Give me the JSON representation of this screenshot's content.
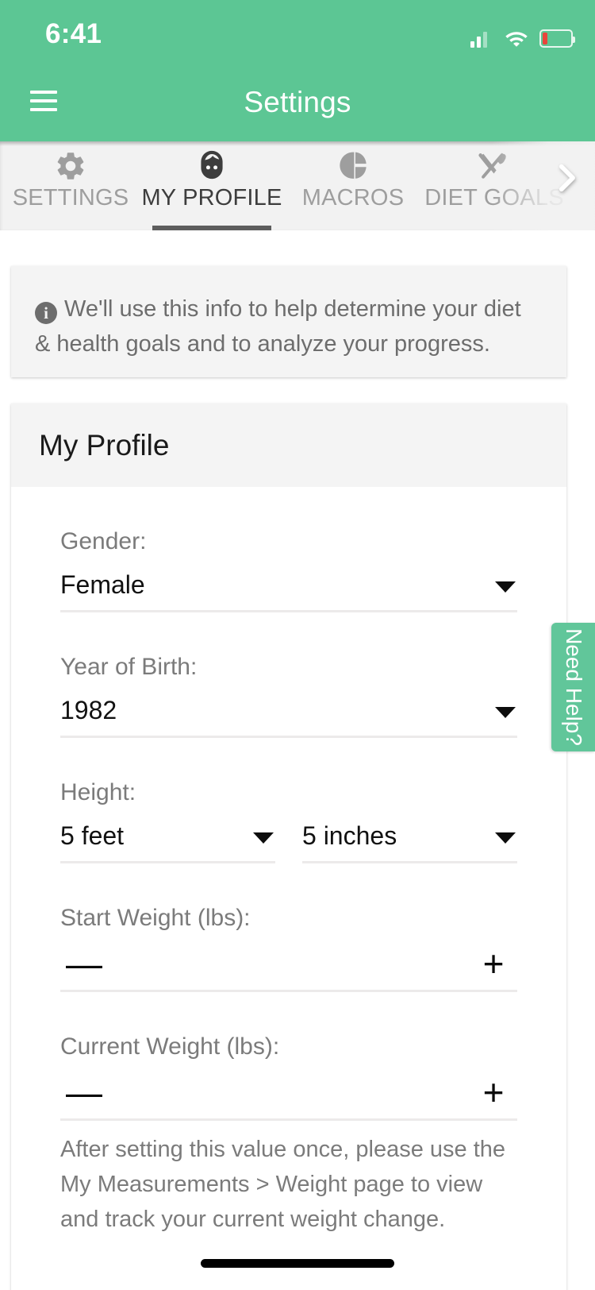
{
  "status_bar": {
    "time": "6:41",
    "signal_icon": "cellular-signal-icon",
    "wifi_icon": "wifi-icon",
    "battery_icon": "battery-low-icon",
    "battery_level_percent": 18
  },
  "nav": {
    "menu_icon": "hamburger-menu-icon",
    "title": "Settings"
  },
  "tabs": {
    "items": [
      {
        "label": "SETTINGS",
        "icon": "gear-icon",
        "active": false
      },
      {
        "label": "MY PROFILE",
        "icon": "face-icon",
        "active": true
      },
      {
        "label": "MACROS",
        "icon": "pie-chart-icon",
        "active": false
      },
      {
        "label": "DIET GOALS",
        "icon": "utensils-icon",
        "active": false
      }
    ],
    "next_icon": "chevron-right-icon"
  },
  "info_banner": {
    "icon": "info-icon",
    "text": "We'll use this info to help determine your diet & health goals and to analyze your progress."
  },
  "profile_card": {
    "title": "My Profile",
    "fields": {
      "gender": {
        "label": "Gender:",
        "value": "Female"
      },
      "year_of_birth": {
        "label": "Year of Birth:",
        "value": "1982"
      },
      "height": {
        "label": "Height:",
        "feet_value": "5 feet",
        "inches_value": "5 inches"
      },
      "start_weight": {
        "label": "Start Weight (lbs):",
        "value": "",
        "minus_label": "—",
        "plus_label": "+"
      },
      "current_weight": {
        "label": "Current Weight (lbs):",
        "value": "",
        "minus_label": "—",
        "plus_label": "+",
        "hint": "After setting this value once, please use the My Measurements > Weight page to view and track your current weight change."
      }
    }
  },
  "need_help": {
    "label": "Need Help?"
  },
  "colors": {
    "brand_green": "#5cc694",
    "help_tab_green": "#61c69a",
    "card_grey": "#f4f4f4",
    "tabbar_grey": "#f2f2f2",
    "label_grey": "#7b7b7b",
    "battery_red": "#e8453c",
    "active_tab_dark": "#3d3d3d"
  }
}
